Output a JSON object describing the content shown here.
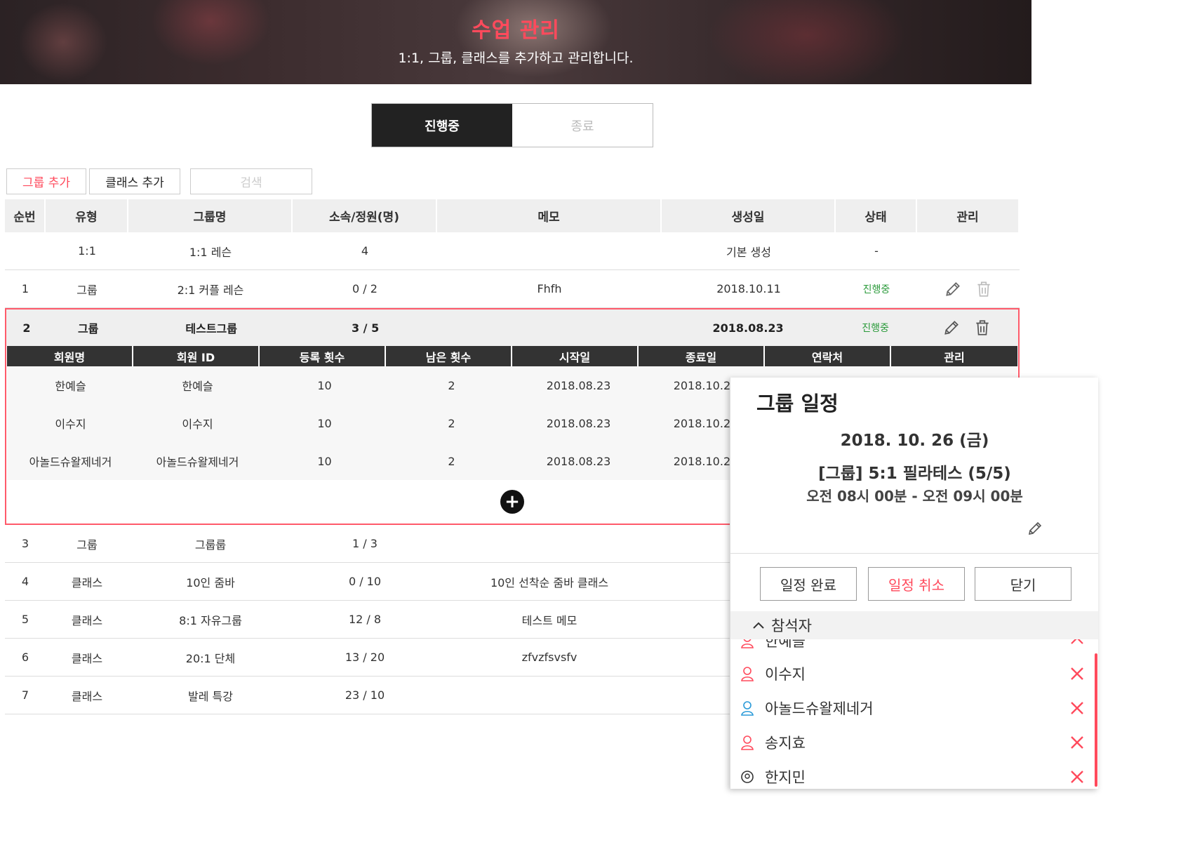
{
  "banner": {
    "title": "수업 관리",
    "subtitle": "1:1, 그룹, 클래스를 추가하고 관리합니다."
  },
  "status_tabs": {
    "active": "진행중",
    "inactive": "종료"
  },
  "actions": {
    "add_group": "그룹 추가",
    "add_class": "클래스 추가",
    "search": "검색"
  },
  "table": {
    "headers": [
      "순번",
      "유형",
      "그룹명",
      "소속/정원(명)",
      "메모",
      "생성일",
      "상태",
      "관리"
    ],
    "rows": [
      {
        "no": "",
        "type": "1:1",
        "name": "1:1 레슨",
        "members": "4",
        "memo": "",
        "created": "기본 생성",
        "status": "-"
      },
      {
        "no": "1",
        "type": "그룹",
        "name": "2:1 커플 레슨",
        "members": "0 / 2",
        "memo": "Fhfh",
        "created": "2018.10.11",
        "status": "진행중"
      },
      {
        "no": "2",
        "type": "그룹",
        "name": "테스트그룹",
        "members": "3 / 5",
        "memo": "",
        "created": "2018.08.23",
        "status": "진행중"
      },
      {
        "no": "3",
        "type": "그룹",
        "name": "그룹룹",
        "members": "1 / 3",
        "memo": "",
        "created": "20"
      },
      {
        "no": "4",
        "type": "클래스",
        "name": "10인 줌바",
        "members": "0 / 10",
        "memo": "10인 선착순 줌바 클래스",
        "created": "20"
      },
      {
        "no": "5",
        "type": "클래스",
        "name": "8:1 자유그룹",
        "members": "12 / 8",
        "memo": "테스트 메모",
        "created": "20"
      },
      {
        "no": "6",
        "type": "클래스",
        "name": "20:1 단체",
        "members": "13 / 20",
        "memo": "zfvzfsvsfv",
        "created": "20"
      },
      {
        "no": "7",
        "type": "클래스",
        "name": "발레 특강",
        "members": "23 / 10",
        "memo": "",
        "created": "20"
      }
    ]
  },
  "sub_table": {
    "headers": [
      "회원명",
      "회원 ID",
      "등록 횟수",
      "남은 횟수",
      "시작일",
      "종료일",
      "연락처",
      "관리"
    ],
    "rows": [
      {
        "name": "한예슬",
        "id": "한예슬",
        "registered": "10",
        "remaining": "2",
        "start": "2018.08.23",
        "end": "2018.10.23"
      },
      {
        "name": "이수지",
        "id": "이수지",
        "registered": "10",
        "remaining": "2",
        "start": "2018.08.23",
        "end": "2018.10.23"
      },
      {
        "name": "아놀드슈왈제네거",
        "id": "아놀드슈왈제네거",
        "registered": "10",
        "remaining": "2",
        "start": "2018.08.23",
        "end": "2018.10.23"
      }
    ]
  },
  "popup": {
    "title": "그룹 일정",
    "date": "2018. 10. 26 (금)",
    "class": "[그룹] 5:1 필라테스 (5/5)",
    "time": "오전 08시 00분 - 오전 09시 00분",
    "btn_complete": "일정 완료",
    "btn_cancel": "일정 취소",
    "btn_close": "닫기",
    "attendees_label": "참석자",
    "attendees": [
      {
        "name": "한예슬",
        "icon": "female-user-icon",
        "color": "#ff4a5c"
      },
      {
        "name": "이수지",
        "icon": "female-user-icon",
        "color": "#ff4a5c"
      },
      {
        "name": "아놀드슈왈제네거",
        "icon": "male-user-icon",
        "color": "#2a9ad8"
      },
      {
        "name": "송지효",
        "icon": "female-user-icon",
        "color": "#ff4a5c"
      },
      {
        "name": "한지민",
        "icon": "unknown-user-icon",
        "color": "#333333"
      }
    ]
  },
  "colors": {
    "accent": "#ff4a5c",
    "status_green": "#2a9a3a",
    "dark": "#222222"
  }
}
